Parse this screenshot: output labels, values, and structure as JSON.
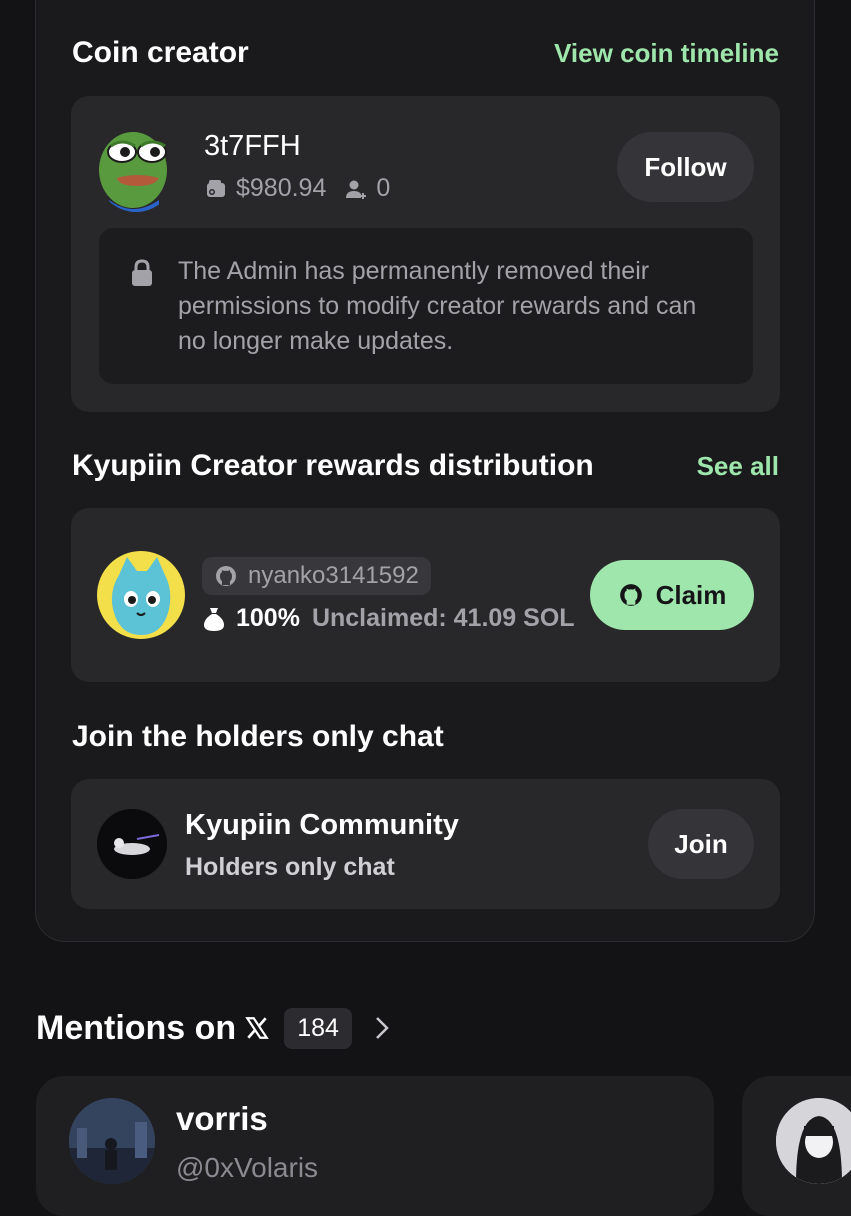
{
  "coin_creator": {
    "title": "Coin creator",
    "timeline_link": "View coin timeline",
    "username": "3t7FFH",
    "balance": "$980.94",
    "followers": "0",
    "follow_label": "Follow",
    "lock_notice": "The Admin has permanently removed their permissions to modify creator rewards and can no longer make updates."
  },
  "rewards": {
    "title": "Kyupiin Creator rewards distribution",
    "see_all": "See all",
    "github_user": "nyanko3141592",
    "share": "100%",
    "unclaimed": "Unclaimed: 41.09 SOL",
    "claim_label": "Claim"
  },
  "chat": {
    "title": "Join the holders only chat",
    "community_name": "Kyupiin Community",
    "subtitle": "Holders only chat",
    "join_label": "Join"
  },
  "mentions": {
    "title": "Mentions on",
    "count": "184",
    "first": {
      "name": "vorris",
      "handle": "@0xVolaris"
    }
  },
  "colors": {
    "accent_green": "#9ee6ab",
    "background": "#131315",
    "panel": "#28282b"
  }
}
